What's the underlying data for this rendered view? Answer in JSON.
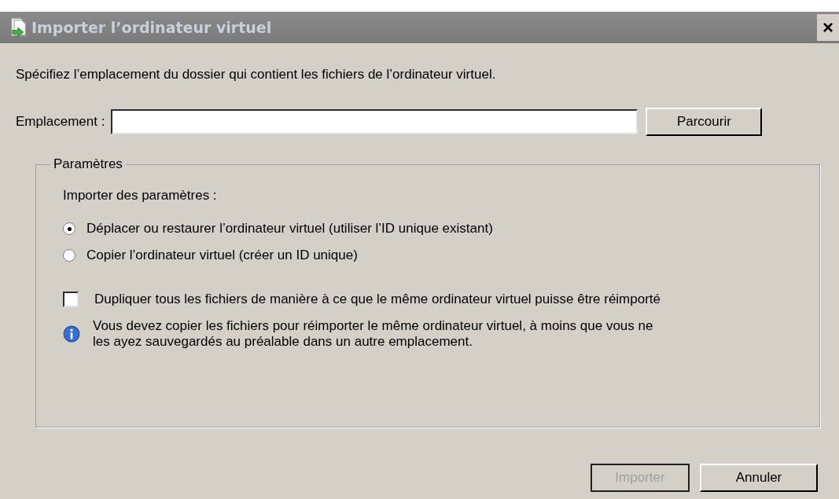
{
  "window": {
    "title": "Importer l’ordinateur virtuel",
    "close": "×"
  },
  "instruction": "Spécifiez l’emplacement du dossier qui contient les fichiers de l’ordinateur virtuel.",
  "location": {
    "label": "Emplacement :",
    "browse": "Parcourir"
  },
  "group": {
    "title": "Paramètres",
    "subtitle": "Importer des paramètres :",
    "options": [
      {
        "label": "Déplacer ou restaurer l’ordinateur virtuel (utiliser l’ID unique existant)",
        "selected": true
      },
      {
        "label": "Copier l’ordinateur virtuel (créer un ID unique)",
        "selected": false
      }
    ],
    "duplicate": {
      "label": "Dupliquer tous les fichiers de manière à ce que le même ordinateur virtuel puisse être réimporté",
      "checked": false
    },
    "info": "Vous devez copier les fichiers pour réimporter le même ordinateur virtuel, à moins que vous ne les ayez sauvegardés au préalable dans un autre emplacement."
  },
  "buttons": [
    {
      "label": "Importer",
      "disabled": true
    },
    {
      "label": "Annuler",
      "disabled": false
    }
  ]
}
